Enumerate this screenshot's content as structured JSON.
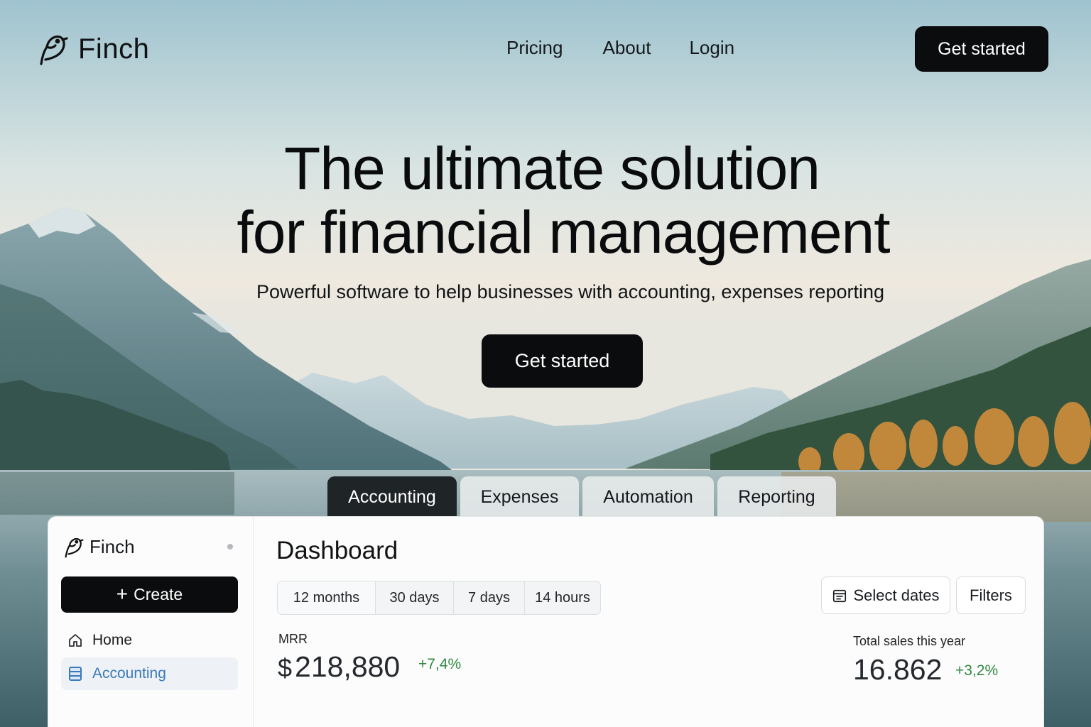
{
  "nav": {
    "brand": "Finch",
    "links": [
      "Pricing",
      "About",
      "Login"
    ],
    "cta": "Get started"
  },
  "hero": {
    "title_line1": "The ultimate solution",
    "title_line2": "for financial management",
    "subtitle": "Powerful software to help businesses with accounting, expenses reporting",
    "cta": "Get started"
  },
  "product_tabs": {
    "items": [
      "Accounting",
      "Expenses",
      "Automation",
      "Reporting"
    ],
    "active": "Accounting"
  },
  "dashboard": {
    "sidebar": {
      "brand": "Finch",
      "create_label": "Create",
      "items": [
        {
          "label": "Home",
          "icon": "home-icon"
        },
        {
          "label": "Accounting",
          "icon": "ledger-icon",
          "active": true
        }
      ]
    },
    "title": "Dashboard",
    "ranges": [
      "12 months",
      "30 days",
      "7 days",
      "14 hours"
    ],
    "selected_range": "12 months",
    "select_dates_label": "Select dates",
    "filters_label": "Filters",
    "mrr": {
      "label": "MRR",
      "currency": "$",
      "value": "218,880",
      "delta": "+7,4%"
    },
    "sales": {
      "label": "Total sales this year",
      "value": "16.862",
      "delta": "+3,2%"
    }
  },
  "colors": {
    "primary_dark": "#0b0c0d",
    "active_tab": "#1f2427",
    "positive": "#2f8a3e",
    "accent_blue": "#3a79b8"
  }
}
